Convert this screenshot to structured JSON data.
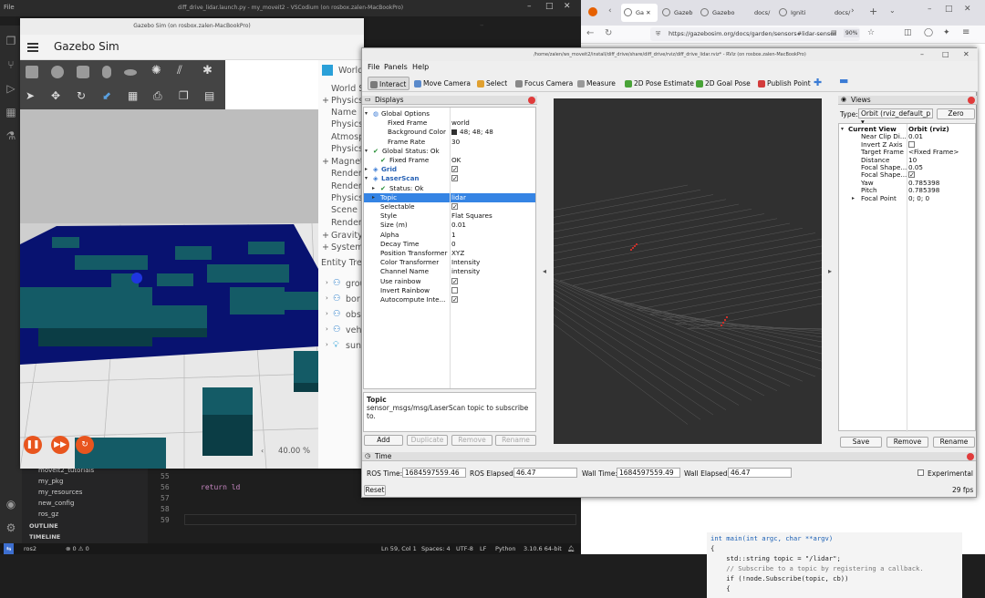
{
  "vscode": {
    "title": "diff_drive_lidar.launch.py - my_moveit2 - VSCodium (on rosbox.zalen-MacBookPro)",
    "menu": "File",
    "explorer": [
      "moveit2_tutorials",
      "my_pkg",
      "my_resources",
      "new_config",
      "ros_gz"
    ],
    "outline": "OUTLINE",
    "timeline": "TIMELINE",
    "line_numbers": [
      "55",
      "56",
      "57",
      "58",
      "59"
    ],
    "code_line": "return ld",
    "status": {
      "branch": "ros2",
      "errors": "⊗ 0 ⚠ 0",
      "position": "Ln 59, Col 1",
      "spaces": "Spaces: 4",
      "encoding": "UTF-8",
      "eol": "LF",
      "lang": "Python",
      "version": "3.10.6 64-bit"
    }
  },
  "browser": {
    "tabs": [
      "Ga",
      "Gazeb",
      "Gazebo",
      "docs/",
      "Igniti",
      "docs/"
    ],
    "url": "https://gazebosim.org/docs/garden/sensors#lidar-sensor",
    "zoom": "90%",
    "code": [
      "int main(int argc, char **argv)",
      "{",
      "    std::string topic = \"/lidar\";",
      "    // Subscribe to a topic by registering a callback.",
      "    if (!node.Subscribe(topic, cb))",
      "    {"
    ]
  },
  "gazebo": {
    "window_title": "Gazebo Sim (on rosbox.zalen-MacBookPro)",
    "title": "Gazebo Sim",
    "right_items": [
      "World",
      "World S",
      "Physics",
      "Name",
      "Physics",
      "Atmosp",
      "Physics",
      "Magnet",
      "Render",
      "Render",
      "Physics",
      "Scene",
      "Render",
      "Gravity",
      "System",
      "Entity Tre",
      "grou",
      "bor",
      "obs",
      "veh",
      "sun"
    ],
    "zoom": "40.00 %",
    "play_icons": [
      "❚❚",
      "▶▶",
      "↻"
    ]
  },
  "rviz": {
    "title": "/home/zalen/ws_moveit2/install/diff_drive/share/diff_drive/rviz/diff_drive_lidar.rviz* - RViz (on rosbox.zalen-MacBookPro)",
    "menu": [
      "File",
      "Panels",
      "Help"
    ],
    "tools": [
      {
        "label": "Interact",
        "color": "#7a7a7a"
      },
      {
        "label": "Move Camera",
        "color": "#5a8acb"
      },
      {
        "label": "Select",
        "color": "#e0a030"
      },
      {
        "label": "Focus Camera",
        "color": "#888888"
      },
      {
        "label": "Measure",
        "color": "#999999"
      },
      {
        "label": "2D Pose Estimate",
        "color": "#49a337"
      },
      {
        "label": "2D Goal Pose",
        "color": "#49a337"
      },
      {
        "label": "Publish Point",
        "color": "#d33c3c"
      }
    ],
    "displays_title": "Displays",
    "displays": [
      {
        "key": "Global Options",
        "value": "",
        "indent": 1,
        "arrow": "▾",
        "icon": "globe"
      },
      {
        "key": "Fixed Frame",
        "value": "world",
        "indent": 3
      },
      {
        "key": "Background Color",
        "value": "48; 48; 48",
        "indent": 3,
        "swatch": "#303030"
      },
      {
        "key": "Frame Rate",
        "value": "30",
        "indent": 3
      },
      {
        "key": "Global Status: Ok",
        "value": "",
        "indent": 1,
        "arrow": "▾",
        "check": true
      },
      {
        "key": "Fixed Frame",
        "value": "OK",
        "indent": 2,
        "check": true
      },
      {
        "key": "Grid",
        "value": "",
        "indent": 1,
        "arrow": "▸",
        "blue": true,
        "cb": true
      },
      {
        "key": "LaserScan",
        "value": "",
        "indent": 1,
        "arrow": "▾",
        "blue": true,
        "cb": true
      },
      {
        "key": "Status: Ok",
        "value": "",
        "indent": 2,
        "arrow": "▸",
        "check": true
      },
      {
        "key": "Topic",
        "value": "lidar",
        "indent": 2,
        "arrow": "▸",
        "selected": true
      },
      {
        "key": "Selectable",
        "value": "",
        "indent": 2,
        "cb": true
      },
      {
        "key": "Style",
        "value": "Flat Squares",
        "indent": 2
      },
      {
        "key": "Size (m)",
        "value": "0.01",
        "indent": 2
      },
      {
        "key": "Alpha",
        "value": "1",
        "indent": 2
      },
      {
        "key": "Decay Time",
        "value": "0",
        "indent": 2
      },
      {
        "key": "Position Transformer",
        "value": "XYZ",
        "indent": 2
      },
      {
        "key": "Color Transformer",
        "value": "Intensity",
        "indent": 2
      },
      {
        "key": "Channel Name",
        "value": "intensity",
        "indent": 2
      },
      {
        "key": "Use rainbow",
        "value": "",
        "indent": 2,
        "cb": true
      },
      {
        "key": "Invert Rainbow",
        "value": "",
        "indent": 2,
        "cb": false
      },
      {
        "key": "Autocompute Inte...",
        "value": "",
        "indent": 2,
        "cb": true
      }
    ],
    "desc_title": "Topic",
    "desc_text": "sensor_msgs/msg/LaserScan topic to subscribe to.",
    "display_buttons": [
      "Add",
      "Duplicate",
      "Remove",
      "Rename"
    ],
    "views_title": "Views",
    "views_type_label": "Type:",
    "views_type": "Orbit (rviz_default_p",
    "views_zero": "Zero",
    "views": [
      {
        "key": "Current View",
        "value": "Orbit (rviz)",
        "bold": true,
        "arrow": "▾"
      },
      {
        "key": "Near Clip Di...",
        "value": "0.01"
      },
      {
        "key": "Invert Z Axis",
        "value": "",
        "cb": false
      },
      {
        "key": "Target Frame",
        "value": "<Fixed Frame>"
      },
      {
        "key": "Distance",
        "value": "10"
      },
      {
        "key": "Focal Shape...",
        "value": "0.05"
      },
      {
        "key": "Focal Shape...",
        "value": "",
        "cb": true
      },
      {
        "key": "Yaw",
        "value": "0.785398"
      },
      {
        "key": "Pitch",
        "value": "0.785398"
      },
      {
        "key": "Focal Point",
        "value": "0; 0; 0",
        "arrow": "▸"
      }
    ],
    "views_buttons": [
      "Save",
      "Remove",
      "Rename"
    ],
    "time_title": "Time",
    "time": {
      "ros_time_label": "ROS Time:",
      "ros_time": "1684597559.46",
      "ros_elapsed_label": "ROS Elapsed:",
      "ros_elapsed": "46.47",
      "wall_time_label": "Wall Time:",
      "wall_time": "1684597559.49",
      "wall_elapsed_label": "Wall Elapsed:",
      "wall_elapsed": "46.47",
      "experimental": "Experimental",
      "reset": "Reset",
      "fps": "29 fps"
    }
  }
}
